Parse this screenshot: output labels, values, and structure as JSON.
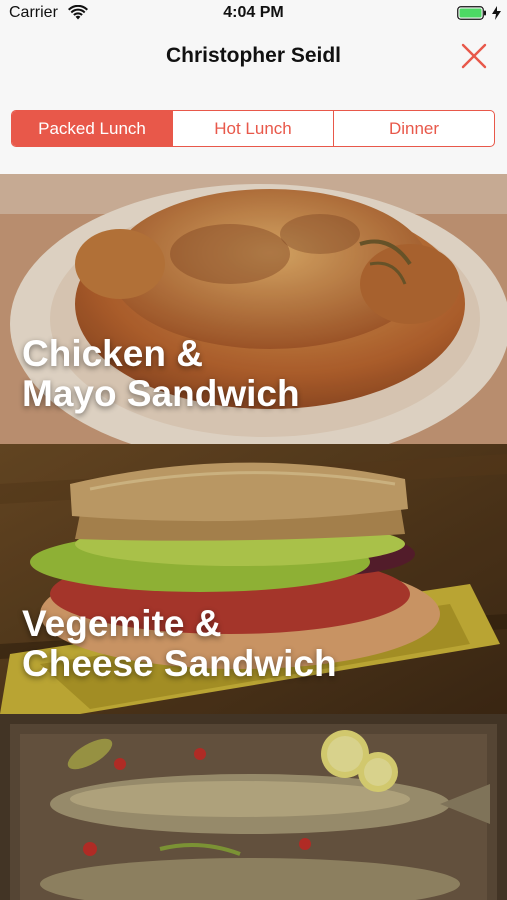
{
  "status_bar": {
    "carrier": "Carrier",
    "time": "4:04 PM",
    "wifi_icon": "wifi-icon",
    "battery_icon": "battery-icon",
    "charging_icon": "charging-icon"
  },
  "nav": {
    "title": "Christopher Seidl",
    "close_icon": "close-icon"
  },
  "segments": [
    {
      "label": "Packed Lunch",
      "selected": true
    },
    {
      "label": "Hot Lunch",
      "selected": false
    },
    {
      "label": "Dinner",
      "selected": false
    }
  ],
  "meals": [
    {
      "line1": "Chicken &",
      "line2": "Mayo Sandwich"
    },
    {
      "line1": "Vegemite &",
      "line2": "Cheese Sandwich"
    },
    {
      "line1": "",
      "line2": ""
    }
  ],
  "colors": {
    "accent": "#e8584a",
    "background": "#f7f7f7",
    "battery": "#4cd964"
  }
}
